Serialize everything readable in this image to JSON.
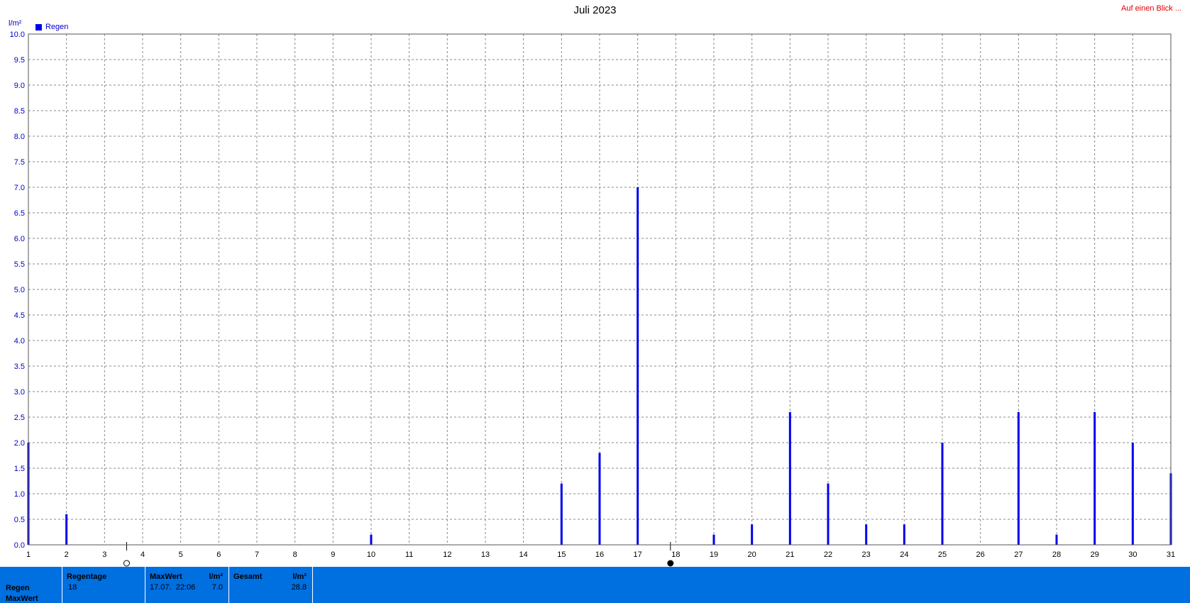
{
  "header": {
    "title": "Juli 2023",
    "link_label": "Auf einen Blick ..."
  },
  "colors": {
    "bar": "#0000ee",
    "footer_bg": "#006fe0",
    "link": "#e00000",
    "axis_text": "#0000cc"
  },
  "chart_data": {
    "type": "bar",
    "title": "Juli 2023",
    "ylabel": "l/m²",
    "ylim": [
      0,
      10
    ],
    "xlim": [
      1,
      31
    ],
    "grid": true,
    "legend": {
      "position": "top-left",
      "entries": [
        "Regen"
      ]
    },
    "y_ticks": [
      "0.0",
      "0.5",
      "1.0",
      "1.5",
      "2.0",
      "2.5",
      "3.0",
      "3.5",
      "4.0",
      "4.5",
      "5.0",
      "5.5",
      "6.0",
      "6.5",
      "7.0",
      "7.5",
      "8.0",
      "8.5",
      "9.0",
      "9.5",
      "10.0"
    ],
    "x_ticks": [
      "1",
      "2",
      "3",
      "4",
      "5",
      "6",
      "7",
      "8",
      "9",
      "10",
      "11",
      "12",
      "13",
      "14",
      "15",
      "16",
      "17",
      "18",
      "19",
      "20",
      "21",
      "22",
      "23",
      "24",
      "25",
      "26",
      "27",
      "28",
      "29",
      "30",
      "31"
    ],
    "series": [
      {
        "name": "Regen",
        "x": [
          1,
          2,
          10,
          15,
          16,
          17,
          19,
          20,
          21,
          22,
          23,
          24,
          25,
          27,
          28,
          29,
          30,
          31
        ],
        "values": [
          2.0,
          0.6,
          0.2,
          1.2,
          1.8,
          7.0,
          0.2,
          0.4,
          2.6,
          1.2,
          0.4,
          0.4,
          2.0,
          2.6,
          0.2,
          2.6,
          2.0,
          1.4
        ]
      }
    ],
    "markers": [
      {
        "kind": "open-circle",
        "x": 3.58
      },
      {
        "kind": "filled-circle",
        "x": 17.86
      }
    ]
  },
  "footer": {
    "row_label_1": "Regen",
    "row_label_2": "MaxWert",
    "regentage_header": "Regentage",
    "regentage_value": "18",
    "maxwert_header": "MaxWert",
    "maxwert_unit": "l/m²",
    "maxwert_date": "17.07.  22:06",
    "maxwert_value": "7.0",
    "gesamt_header": "Gesamt",
    "gesamt_unit": "l/m²",
    "gesamt_value": "28.8"
  }
}
